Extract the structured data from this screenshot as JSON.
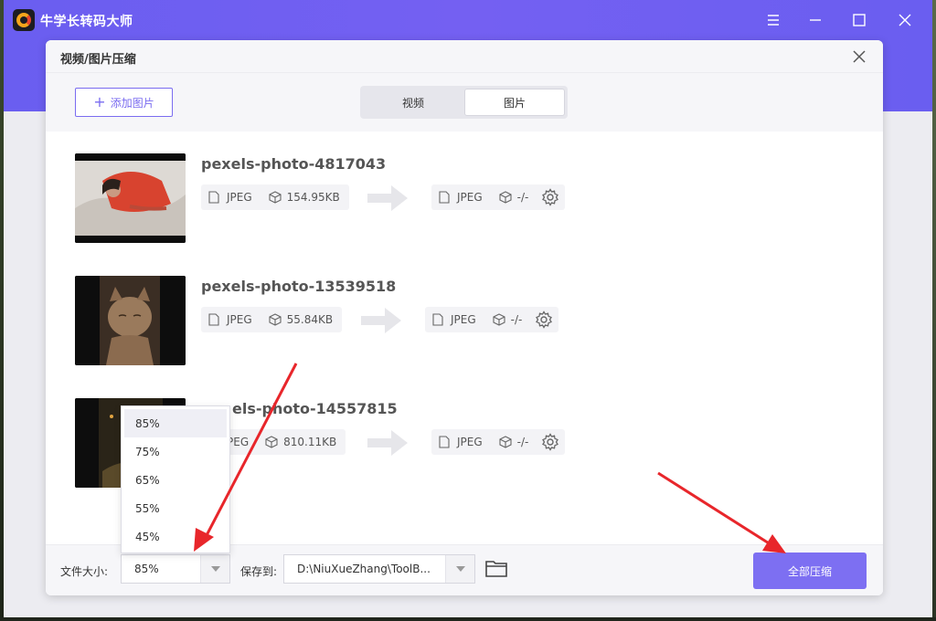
{
  "app": {
    "title": "牛学长转码大师"
  },
  "dialog": {
    "title": "视频/图片压缩",
    "add_button": "添加图片",
    "tabs": [
      {
        "label": "视频"
      },
      {
        "label": "图片"
      }
    ],
    "files": [
      {
        "name": "pexels-photo-4817043",
        "format": "JPEG",
        "size": "154.95KB",
        "out_format": "JPEG",
        "out_size": "-/-"
      },
      {
        "name": "pexels-photo-13539518",
        "format": "JPEG",
        "size": "55.84KB",
        "out_format": "JPEG",
        "out_size": "-/-"
      },
      {
        "name": "els-photo-14557815",
        "format": "PEG",
        "size": "810.11KB",
        "out_format": "JPEG",
        "out_size": "-/-"
      }
    ],
    "bottom": {
      "size_label": "文件大小:",
      "size_value": "85%",
      "save_label": "保存到:",
      "save_path": "D:\\NiuXueZhang\\ToolB...",
      "compress_all": "全部压缩"
    },
    "dropdown_options": [
      "85%",
      "75%",
      "65%",
      "55%",
      "45%"
    ]
  },
  "colors": {
    "accent": "#7d6ff2",
    "titlebar": "#6a5ef0",
    "annotation": "#e8262b"
  }
}
